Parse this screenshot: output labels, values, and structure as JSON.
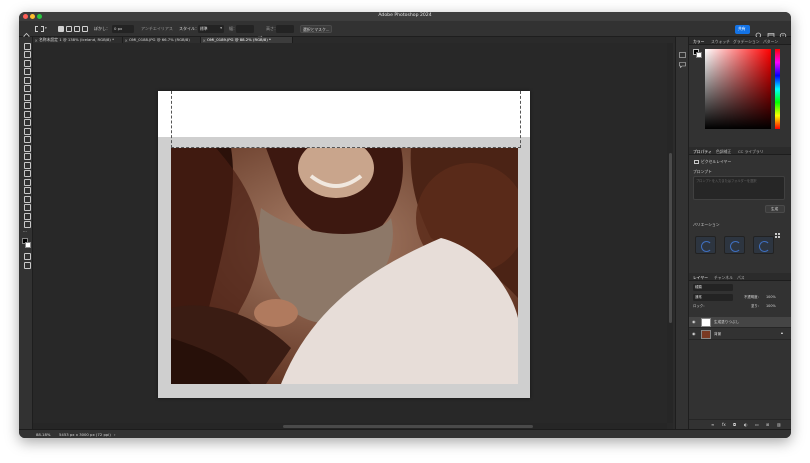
{
  "window": {
    "title": "Adobe Photoshop 2024"
  },
  "options": {
    "feather_label": "ぼかし：",
    "feather_value": "0 px",
    "antialias_label": "アンチエイリアス",
    "style_label": "スタイル：",
    "style_value": "標準",
    "width_label": "幅：",
    "height_label": "高さ：",
    "select_mask_label": "選択とマスク...",
    "share_label": "共有"
  },
  "tabs": [
    {
      "label": "名称未設定 1 @ 138% (Iceland, RGB/8) *",
      "active": false
    },
    {
      "label": "OMI_0188.JPG @ 66.7% (RGB/8)",
      "active": false
    },
    {
      "label": "OMI_0189.JPG @ 88.2% (RGB/8) *",
      "active": true
    }
  ],
  "panels": {
    "color_tabs": [
      "カラー",
      "スウォッチ",
      "グラデーション",
      "パターン"
    ],
    "props_tabs": [
      "プロパティ",
      "色調補正",
      "CC ライブラリ"
    ],
    "pixel_layer_label": "ピクセルレイヤー",
    "generate_label": "プロンプト",
    "generate_placeholder": "プロンプトを入力またはフォルダーを選択",
    "generate_button": "生成",
    "variations_label": "バリエーション",
    "layer_tabs": [
      "レイヤー",
      "チャンネル",
      "パス"
    ],
    "search_kind": "種類",
    "blend_mode": "通常",
    "opacity_label": "不透明度：",
    "opacity_value": "100%",
    "lock_label": "ロック：",
    "fill_label": "塗り：",
    "fill_value": "100%",
    "layers": [
      {
        "name": "生成塗りつぶし",
        "selected": true,
        "locked": false
      },
      {
        "name": "背景",
        "selected": false,
        "locked": true
      }
    ]
  },
  "status": {
    "zoom": "88.18%",
    "dimensions": "5453 px x 3000 px (72 ppi)"
  },
  "colors": {
    "accent": "#1473e6",
    "chrome": "#323232",
    "canvas": "#282828"
  }
}
